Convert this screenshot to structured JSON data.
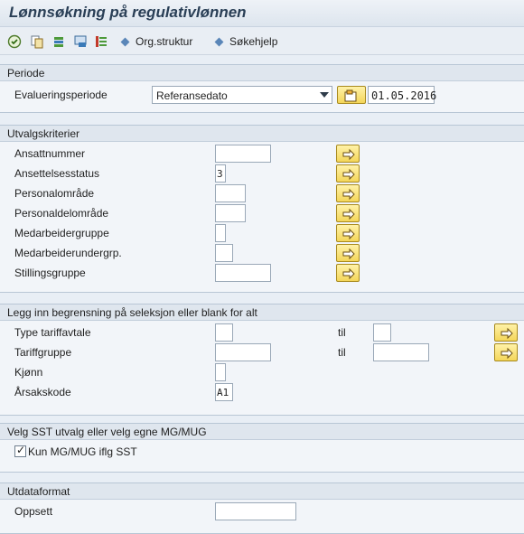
{
  "title": "Lønnsøkning på regulativlønnen",
  "toolbar": {
    "links": [
      "Org.struktur",
      "Søkehjelp"
    ],
    "icons": [
      "execute-icon",
      "copy-icon",
      "variant-icon",
      "save-variant-icon",
      "list-icon"
    ]
  },
  "periode": {
    "header": "Periode",
    "label": "Evalueringsperiode",
    "select_value": "Referansedato",
    "date": "01.05.2016"
  },
  "utvalg": {
    "header": "Utvalgskriterier",
    "rows": [
      {
        "label": "Ansattnummer",
        "value": ""
      },
      {
        "label": "Ansettelsesstatus",
        "value": "3"
      },
      {
        "label": "Personalområde",
        "value": ""
      },
      {
        "label": "Personaldelområde",
        "value": ""
      },
      {
        "label": "Medarbeidergruppe",
        "value": ""
      },
      {
        "label": "Medarbeiderundergrp.",
        "value": ""
      },
      {
        "label": "Stillingsgruppe",
        "value": ""
      }
    ]
  },
  "begrensning": {
    "header": "Legg inn begrensning på seleksjon eller blank for alt",
    "rows": [
      {
        "label": "Type tariffavtale",
        "value": "",
        "til_label": "til",
        "til_value": ""
      },
      {
        "label": "Tariffgruppe",
        "value": "",
        "til_label": "til",
        "til_value": ""
      },
      {
        "label": "Kjønn",
        "value": ""
      },
      {
        "label": "Årsakskode",
        "value": "A1"
      }
    ]
  },
  "sst": {
    "header": "Velg SST utvalg eller velg egne MG/MUG",
    "checkbox_label": "Kun MG/MUG iflg SST",
    "checked": true
  },
  "utdata": {
    "header": "Utdataformat",
    "label": "Oppsett",
    "value": ""
  }
}
